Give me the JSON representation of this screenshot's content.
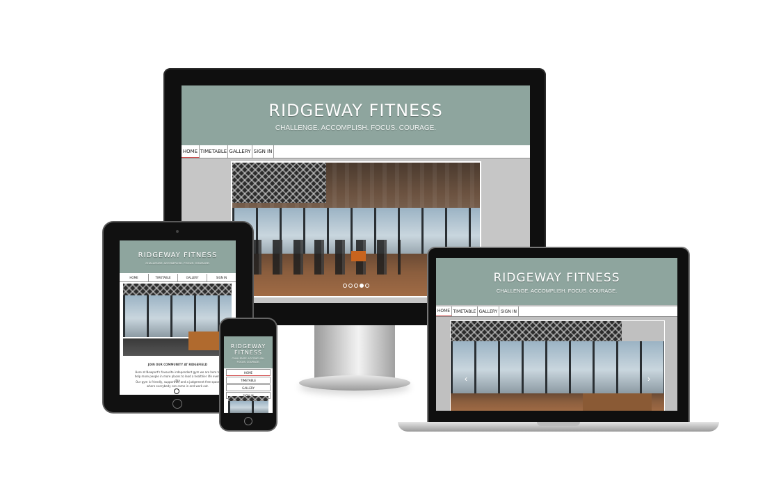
{
  "site": {
    "title": "RIDGEWAY FITNESS",
    "tagline": "CHALLENGE. ACCOMPLISH. FOCUS. COURAGE.",
    "nav": [
      "HOME",
      "TIMETABLE",
      "GALLERY",
      "SIGN IN"
    ]
  },
  "tablet": {
    "title": "RIDGEWAY FITNESS",
    "tagline": "CHALLENGE. ACCOMPLISH. FOCUS. COURAGE.",
    "nav": [
      "HOME",
      "TIMETABLE",
      "GALLERY",
      "SIGN IN"
    ],
    "heading": "JOIN OUR COMMUNITY AT RIDGEFIELD",
    "para1": "Here at Newport's favourite independent gym we are here to help more people in more places to lead a healthier life every day.",
    "para2": "Our gym is friendly, supportive, and a judgement free space where everybody can come in and work out."
  },
  "phone": {
    "title_line1": "RIDGEWAY",
    "title_line2": "FITNESS",
    "tagline_line1": "CHALLENGE. ACCOMPLISH.",
    "tagline_line2": "FOCUS. COURAGE.",
    "nav": [
      "HOME",
      "TIMETABLE",
      "GALLERY",
      "SIGN IN"
    ]
  },
  "laptop": {
    "title": "RIDGEWAY FITNESS",
    "tagline": "CHALLENGE. ACCOMPLISH. FOCUS. COURAGE.",
    "nav": [
      "HOME",
      "TIMETABLE",
      "GALLERY",
      "SIGN IN"
    ],
    "prev_arrow": "‹",
    "next_arrow": "›"
  },
  "carousel": {
    "slides": 5,
    "active_index": 3
  },
  "colors": {
    "header": "#8ea59e",
    "bezel": "#0f0f0f",
    "screen_bg": "#c6c6c6",
    "nav_active_underline": "#d24a4a"
  }
}
